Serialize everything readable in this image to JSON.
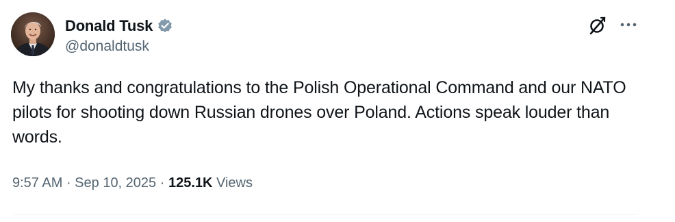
{
  "author": {
    "display_name": "Donald Tusk",
    "handle": "@donaldtusk",
    "verified_icon": "verified-badge-icon",
    "verified_color": "#829aab"
  },
  "actions": {
    "grok_icon": "grok-icon",
    "more_icon": "more-options-icon"
  },
  "tweet": {
    "text": "My thanks and congratulations to the Polish Operational Command and our NATO pilots for shooting down Russian drones over Poland. Actions speak louder than words."
  },
  "meta": {
    "time": "9:57 AM",
    "separator": " · ",
    "date": "Sep 10, 2025",
    "views_count": "125.1K",
    "views_label": " Views"
  },
  "colors": {
    "text": "#0f1419",
    "secondary": "#536471",
    "divider": "#eff3f4"
  }
}
